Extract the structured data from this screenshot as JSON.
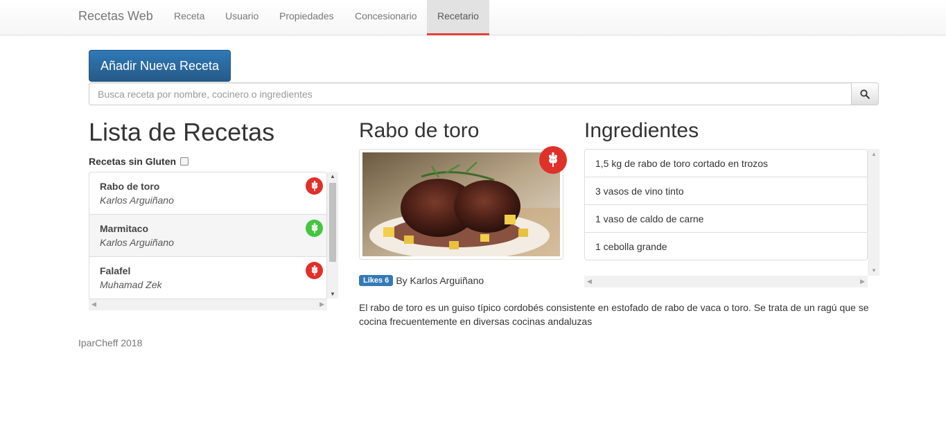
{
  "navbar": {
    "brand": "Recetas Web",
    "items": [
      {
        "label": "Receta"
      },
      {
        "label": "Usuario"
      },
      {
        "label": "Propiedades"
      },
      {
        "label": "Concesionario"
      },
      {
        "label": "Recetario",
        "active": true
      }
    ]
  },
  "actions": {
    "add_label": "Añadir Nueva Receta"
  },
  "search": {
    "placeholder": "Busca receta por nombre, cocinero o ingredientes",
    "icon": "search-icon"
  },
  "list": {
    "title": "Lista de Recetas",
    "gluten_filter_label": "Recetas sin Gluten",
    "items": [
      {
        "title": "Rabo de toro",
        "author": "Karlos Arguiñano",
        "gluten": true,
        "badge_color": "#e0302a"
      },
      {
        "title": "Marmitaco",
        "author": "Karlos Arguiñano",
        "gluten": false,
        "badge_color": "#46c540"
      },
      {
        "title": "Falafel",
        "author": "Muhamad Zek",
        "gluten": true,
        "badge_color": "#e0302a"
      }
    ]
  },
  "recipe": {
    "title": "Rabo de toro",
    "likes_label": "Likes 6",
    "author_line": "By Karlos Arguiñano",
    "description": "El rabo de toro es un guiso típico cordobés consistente en estofado de rabo de vaca o toro. Se trata de un ragú que se cocina frecuentemente en diversas cocinas andaluzas",
    "badge_icon": "wheat-icon",
    "badge_color": "#e0302a"
  },
  "ingredients": {
    "title": "Ingredientes",
    "items": [
      "1,5 kg de rabo de toro cortado en trozos",
      "3 vasos de vino tinto",
      "1 vaso de caldo de carne",
      "1 cebolla grande"
    ]
  },
  "footer": {
    "text": "IparCheff 2018"
  },
  "colors": {
    "accent": "#e0443a",
    "primary": "#2f79b7",
    "gluten": "#e0302a",
    "gluten_free": "#46c540"
  }
}
